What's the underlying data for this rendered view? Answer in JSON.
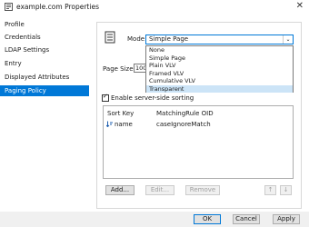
{
  "window": {
    "title": "example.com Properties",
    "close_glyph": "✕"
  },
  "sidebar": {
    "items": [
      {
        "label": "Profile"
      },
      {
        "label": "Credentials"
      },
      {
        "label": "LDAP Settings"
      },
      {
        "label": "Entry"
      },
      {
        "label": "Displayed Attributes"
      },
      {
        "label": "Paging Policy",
        "selected": true
      }
    ]
  },
  "paging": {
    "mode_label": "Mode:",
    "mode_value": "Simple Page",
    "mode_arrow": "⌄",
    "mode_options": [
      "None",
      "Simple Page",
      "Plain VLV",
      "Framed VLV",
      "Cumulative VLV",
      "Transparent"
    ],
    "highlighted_option": "Transparent",
    "page_size_label": "Page Size:",
    "page_size_value": "1000",
    "server_sorting": {
      "label": "Enable server-side sorting",
      "checked": true,
      "check_glyph": "✓"
    },
    "sort_table": {
      "columns": [
        "Sort Key",
        "MatchingRule OID"
      ],
      "rows": [
        {
          "key": "name",
          "rule": "caseIgnoreMatch"
        }
      ]
    },
    "buttons": {
      "add": "Add...",
      "edit": "Edit...",
      "remove": "Remove",
      "up_glyph": "↑",
      "down_glyph": "↓"
    }
  },
  "footer": {
    "ok": "OK",
    "cancel": "Cancel",
    "apply": "Apply"
  },
  "colors": {
    "accent": "#0078d7",
    "selection_highlight": "#cce4f7"
  }
}
